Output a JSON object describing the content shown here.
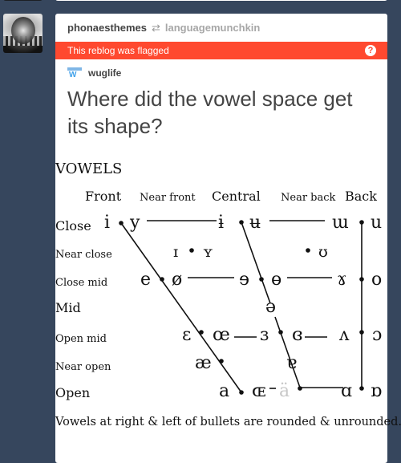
{
  "post": {
    "author": "phonaesthemes",
    "reblog_icon": "reblog-icon",
    "source": "languagemunchkin",
    "flag_text": "This reblog was flagged",
    "help_icon": "?",
    "blog_name": "wuglife",
    "blog_icon_text": "W",
    "title": "Where did the vowel space get its shape?"
  },
  "chart_data": {
    "type": "diagram",
    "title": "VOWELS",
    "columns": [
      "Front",
      "Near front",
      "Central",
      "Near back",
      "Back"
    ],
    "rows": [
      "Close",
      "Near close",
      "Close mid",
      "Mid",
      "Open mid",
      "Near open",
      "Open"
    ],
    "vowels": {
      "close": [
        "i",
        "y",
        "ɨ",
        "ʉ",
        "ɯ",
        "u"
      ],
      "near_close": [
        "ɪ",
        "ʏ",
        "ʊ"
      ],
      "close_mid": [
        "e",
        "ø",
        "ɘ",
        "ɵ",
        "ɤ",
        "o"
      ],
      "mid": [
        "ə"
      ],
      "open_mid": [
        "ɛ",
        "œ",
        "ɜ",
        "ɞ",
        "ʌ",
        "ɔ"
      ],
      "near_open": [
        "æ",
        "ɐ"
      ],
      "open": [
        "a",
        "ɶ",
        "ä",
        "ɑ",
        "ɒ"
      ]
    },
    "caption": "Vowels at right & left of bullets are rounded & unrounded."
  }
}
